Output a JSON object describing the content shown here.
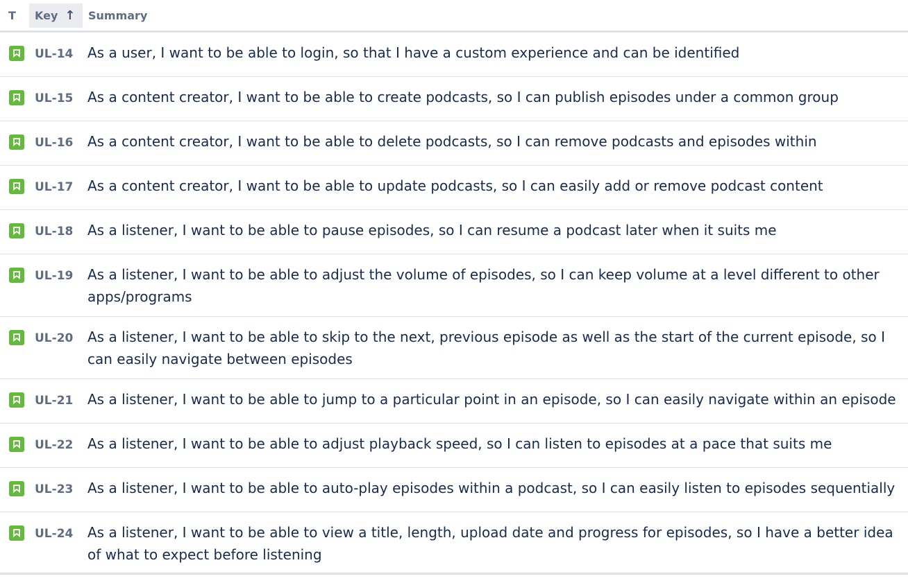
{
  "header": {
    "type_label": "T",
    "key_label": "Key",
    "sort_icon": "arrow-up-icon",
    "summary_label": "Summary"
  },
  "colors": {
    "story_icon": "#63ba3c",
    "key_text": "#5e6c84",
    "summary_text": "#172b4d",
    "divider": "#dfe1e6"
  },
  "rows": [
    {
      "key": "UL-14",
      "summary": "As a user, I want to be able to login, so that I have a custom experience and can be identified"
    },
    {
      "key": "UL-15",
      "summary": "As a content creator, I want to be able to create podcasts, so I can publish episodes under a common group"
    },
    {
      "key": "UL-16",
      "summary": "As a content creator, I want to be able to delete podcasts, so I can remove podcasts and episodes within"
    },
    {
      "key": "UL-17",
      "summary": "As a content creator, I want to be able to update podcasts, so I can easily add or remove podcast content"
    },
    {
      "key": "UL-18",
      "summary": "As a listener, I want to be able to pause episodes, so I can resume a podcast later when it suits me"
    },
    {
      "key": "UL-19",
      "summary": "As a listener, I want to be able to adjust the volume of episodes, so I can keep volume at a level different to other apps/programs"
    },
    {
      "key": "UL-20",
      "summary": "As a listener, I want to be able to skip to the next, previous episode as well as the start of the current episode, so I can easily navigate between episodes"
    },
    {
      "key": "UL-21",
      "summary": "As a listener, I want to be able to jump to a particular point in an episode, so I can easily navigate within an episode"
    },
    {
      "key": "UL-22",
      "summary": "As a listener, I want to be able to adjust playback speed, so I can listen to episodes at a pace that suits me"
    },
    {
      "key": "UL-23",
      "summary": "As a listener, I want to be able to auto-play episodes within a podcast, so I can easily listen to episodes sequentially"
    },
    {
      "key": "UL-24",
      "summary": "As a listener, I want to be able to view a title, length, upload date and progress for episodes, so I have a better idea of what to expect before listening"
    }
  ]
}
